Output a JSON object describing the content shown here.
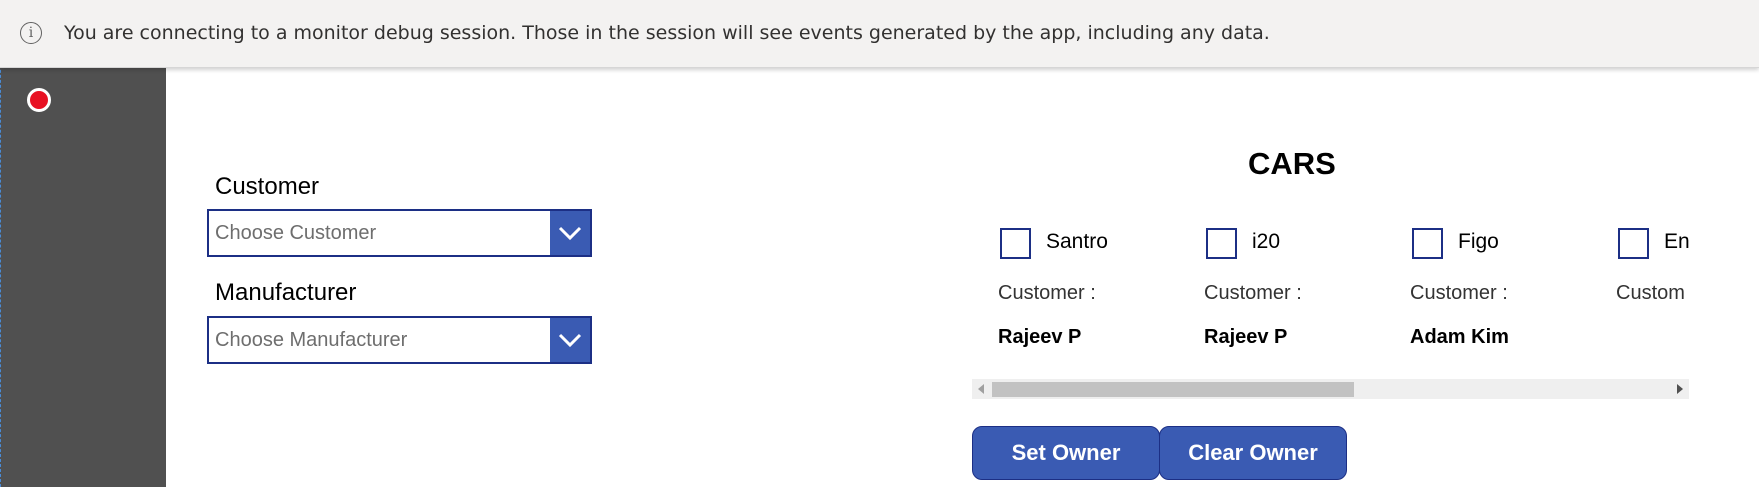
{
  "notice": {
    "icon": "info-icon",
    "text": "You are connecting to a monitor debug session. Those in the session will see events generated by the app, including any data."
  },
  "sidebar": {
    "record_icon": "record-icon",
    "record_color": "#e81123"
  },
  "form": {
    "customer_label": "Customer",
    "customer_placeholder": "Choose Customer",
    "manufacturer_label": "Manufacturer",
    "manufacturer_placeholder": "Choose Manufacturer"
  },
  "cars": {
    "title": "CARS",
    "items": [
      {
        "name": "Santro",
        "customer_label": "Customer :",
        "customer": "Rajeev P",
        "checked": false
      },
      {
        "name": "i20",
        "customer_label": "Customer :",
        "customer": "Rajeev P",
        "checked": false
      },
      {
        "name": "Figo",
        "customer_label": "Customer :",
        "customer": "Adam Kim",
        "checked": false
      },
      {
        "name": "En",
        "customer_label": "Custom",
        "customer": "",
        "checked": false
      }
    ]
  },
  "actions": {
    "set_owner": "Set Owner",
    "clear_owner": "Clear Owner"
  },
  "colors": {
    "accent": "#3a5bb3",
    "border": "#1c2f85",
    "sidebar": "#505050"
  }
}
